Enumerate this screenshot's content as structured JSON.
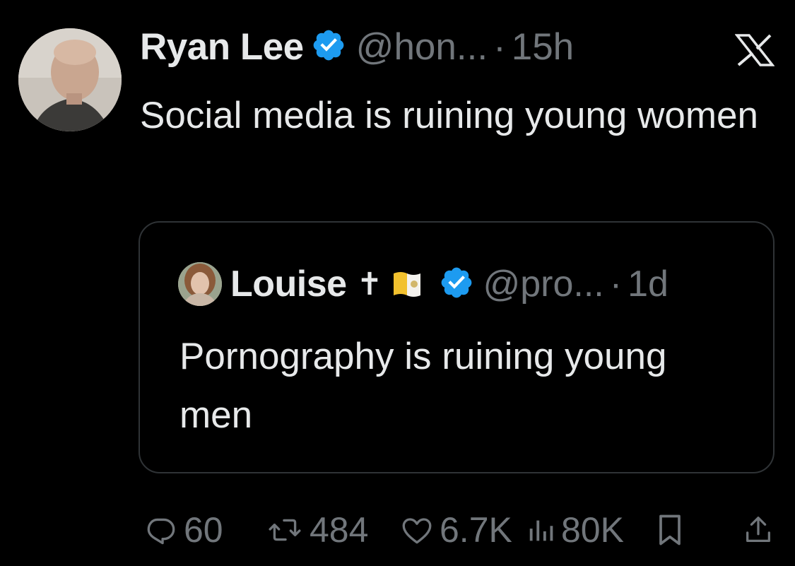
{
  "tweet": {
    "author_name": "Ryan Lee",
    "handle": "@hon...",
    "separator": "·",
    "time": "15h",
    "text": "Social media is ruining young women"
  },
  "quoted_tweet": {
    "author_name": "Louise",
    "name_emoji_cross": "✝",
    "name_emoji_flag": "vatican-flag-emoji",
    "handle": "@pro...",
    "separator": "·",
    "time": "1d",
    "text": "Pornography is ruining young men"
  },
  "actions": {
    "replies": "60",
    "retweets": "484",
    "likes": "6.7K",
    "views": "80K"
  },
  "colors": {
    "background": "#000000",
    "primary_text": "#e7e9ea",
    "secondary_text": "#71767b",
    "verified_blue": "#1d9bf0",
    "card_border": "#2f3336"
  },
  "icons": {
    "verified": "verified-badge-icon",
    "platform": "x-logo-icon",
    "reply": "reply-icon",
    "retweet": "retweet-icon",
    "like": "heart-icon",
    "views": "views-icon",
    "bookmark": "bookmark-icon",
    "share": "share-icon"
  }
}
